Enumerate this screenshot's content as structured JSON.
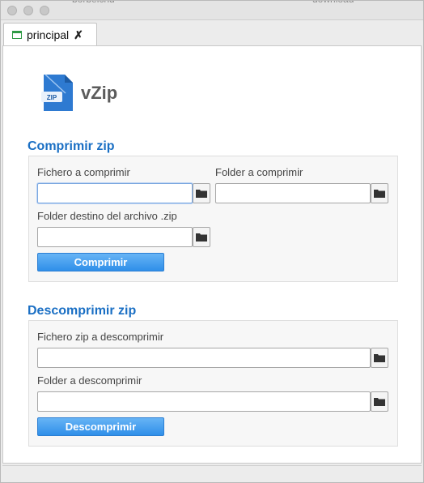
{
  "titlebar": {
    "ghost_left": "borbeichd",
    "ghost_right": "download"
  },
  "tab": {
    "label": "principal",
    "close_glyph": "✗",
    "icon": "window-icon"
  },
  "app": {
    "name": "vZip",
    "logo_icon": "zip-file-icon",
    "logo_text": "ZIP"
  },
  "compress": {
    "title": "Comprimir zip",
    "file_label": "Fichero a comprimir",
    "file_value": "",
    "folder_label": "Folder a comprimir",
    "folder_value": "",
    "dest_label": "Folder destino del archivo .zip",
    "dest_value": "",
    "button_label": "Comprimir"
  },
  "decompress": {
    "title": "Descomprimir zip",
    "zip_label": "Fichero zip a descomprimir",
    "zip_value": "",
    "folder_label": "Folder a descomprimir",
    "folder_value": "",
    "button_label": "Descomprimir"
  },
  "icons": {
    "browse": "folder-icon"
  },
  "colors": {
    "accent": "#1a6fc4",
    "button": "#3c95ea"
  }
}
